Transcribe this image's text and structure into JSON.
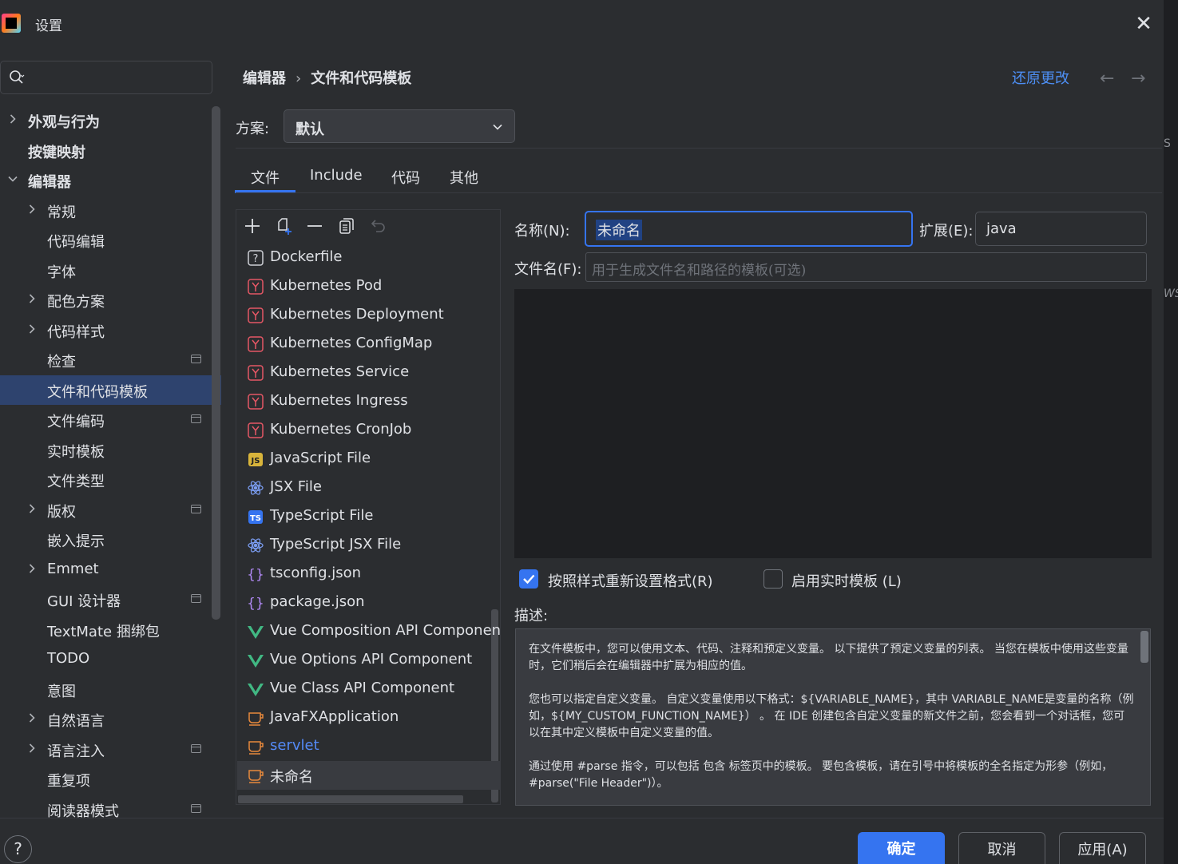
{
  "window": {
    "title": "设置",
    "close": "✕"
  },
  "search": {
    "placeholder": ""
  },
  "sidebar": {
    "items": [
      {
        "label": "外观与行为",
        "expandable": true,
        "expanded": false,
        "level": 0,
        "bold": true
      },
      {
        "label": "按键映射",
        "expandable": false,
        "level": 0,
        "bold": true
      },
      {
        "label": "编辑器",
        "expandable": true,
        "expanded": true,
        "level": 0,
        "bold": true
      },
      {
        "label": "常规",
        "expandable": true,
        "level": 1
      },
      {
        "label": "代码编辑",
        "expandable": false,
        "level": 1
      },
      {
        "label": "字体",
        "expandable": false,
        "level": 1
      },
      {
        "label": "配色方案",
        "expandable": true,
        "level": 1
      },
      {
        "label": "代码样式",
        "expandable": true,
        "level": 1
      },
      {
        "label": "检查",
        "expandable": false,
        "level": 1,
        "project": true
      },
      {
        "label": "文件和代码模板",
        "expandable": false,
        "level": 1,
        "selected": true
      },
      {
        "label": "文件编码",
        "expandable": false,
        "level": 1,
        "project": true
      },
      {
        "label": "实时模板",
        "expandable": false,
        "level": 1
      },
      {
        "label": "文件类型",
        "expandable": false,
        "level": 1
      },
      {
        "label": "版权",
        "expandable": true,
        "level": 1,
        "project": true
      },
      {
        "label": "嵌入提示",
        "expandable": false,
        "level": 1
      },
      {
        "label": "Emmet",
        "expandable": true,
        "level": 1
      },
      {
        "label": "GUI 设计器",
        "expandable": false,
        "level": 1,
        "project": true
      },
      {
        "label": "TextMate 捆绑包",
        "expandable": false,
        "level": 1
      },
      {
        "label": "TODO",
        "expandable": false,
        "level": 1
      },
      {
        "label": "意图",
        "expandable": false,
        "level": 1
      },
      {
        "label": "自然语言",
        "expandable": true,
        "level": 1
      },
      {
        "label": "语言注入",
        "expandable": true,
        "level": 1,
        "project": true
      },
      {
        "label": "重复项",
        "expandable": false,
        "level": 1
      },
      {
        "label": "阅读器模式",
        "expandable": false,
        "level": 1,
        "project": true
      }
    ]
  },
  "breadcrumb": {
    "parent": "编辑器",
    "separator": "›",
    "current": "文件和代码模板"
  },
  "header": {
    "reset_link": "还原更改",
    "back": "←",
    "forward": "→"
  },
  "scheme": {
    "label": "方案:",
    "value": "默认"
  },
  "tabs": [
    {
      "label": "文件",
      "active": true
    },
    {
      "label": "Include"
    },
    {
      "label": "代码"
    },
    {
      "label": "其他"
    }
  ],
  "templates": [
    {
      "name": "Dockerfile",
      "icon": "question-file-icon"
    },
    {
      "name": "Kubernetes Pod",
      "icon": "yaml-icon"
    },
    {
      "name": "Kubernetes Deployment",
      "icon": "yaml-icon"
    },
    {
      "name": "Kubernetes ConfigMap",
      "icon": "yaml-icon"
    },
    {
      "name": "Kubernetes Service",
      "icon": "yaml-icon"
    },
    {
      "name": "Kubernetes Ingress",
      "icon": "yaml-icon"
    },
    {
      "name": "Kubernetes CronJob",
      "icon": "yaml-icon"
    },
    {
      "name": "JavaScript File",
      "icon": "javascript-icon"
    },
    {
      "name": "JSX File",
      "icon": "react-icon"
    },
    {
      "name": "TypeScript File",
      "icon": "typescript-icon"
    },
    {
      "name": "TypeScript JSX File",
      "icon": "react-icon"
    },
    {
      "name": "tsconfig.json",
      "icon": "json-icon"
    },
    {
      "name": "package.json",
      "icon": "json-icon"
    },
    {
      "name": "Vue Composition API Component",
      "icon": "vue-icon"
    },
    {
      "name": "Vue Options API Component",
      "icon": "vue-icon"
    },
    {
      "name": "Vue Class API Component",
      "icon": "vue-icon"
    },
    {
      "name": "JavaFXApplication",
      "icon": "java-cup-icon"
    },
    {
      "name": "servlet",
      "icon": "java-cup-icon",
      "highlight": true
    },
    {
      "name": "未命名",
      "icon": "java-cup-icon",
      "selected": true
    }
  ],
  "form": {
    "name_label": "名称(N):",
    "name_value": "未命名",
    "ext_label": "扩展(E):",
    "ext_value": "java",
    "filename_label": "文件名(F):",
    "filename_placeholder": "用于生成文件名和路径的模板(可选)",
    "reformat_label": "按照样式重新设置格式(R)",
    "reformat_checked": true,
    "live_template_label": "启用实时模板 (L)",
    "live_template_checked": false,
    "description_label": "描述:"
  },
  "description": {
    "p1": "在文件模板中，您可以使用文本、代码、注释和预定义变量。 以下提供了预定义变量的列表。 当您在模板中使用这些变量时，它们稍后会在编辑器中扩展为相应的值。",
    "p2": "您也可以指定自定义变量。 自定义变量使用以下格式：${VARIABLE_NAME}，其中 VARIABLE_NAME是变量的名称（例如，${MY_CUSTOM_FUNCTION_NAME}） 。 在 IDE 创建包含自定义变量的新文件之前，您会看到一个对话框，您可以在其中定义模板中自定义变量的值。",
    "p3": "通过使用 #parse 指令，可以包括 包含 标签页中的模板。 要包含模板，请在引号中将模板的全名指定为形参（例如，#parse(\"File Header\")）。"
  },
  "footer": {
    "help": "?",
    "ok": "确定",
    "cancel": "取消",
    "apply": "应用(A)"
  },
  "edge": {
    "s": "S",
    "ws": "WS"
  },
  "colors": {
    "accent": "#3574f0",
    "link": "#4d8ff5",
    "selection": "#2e436e",
    "background": "#2b2d30"
  }
}
